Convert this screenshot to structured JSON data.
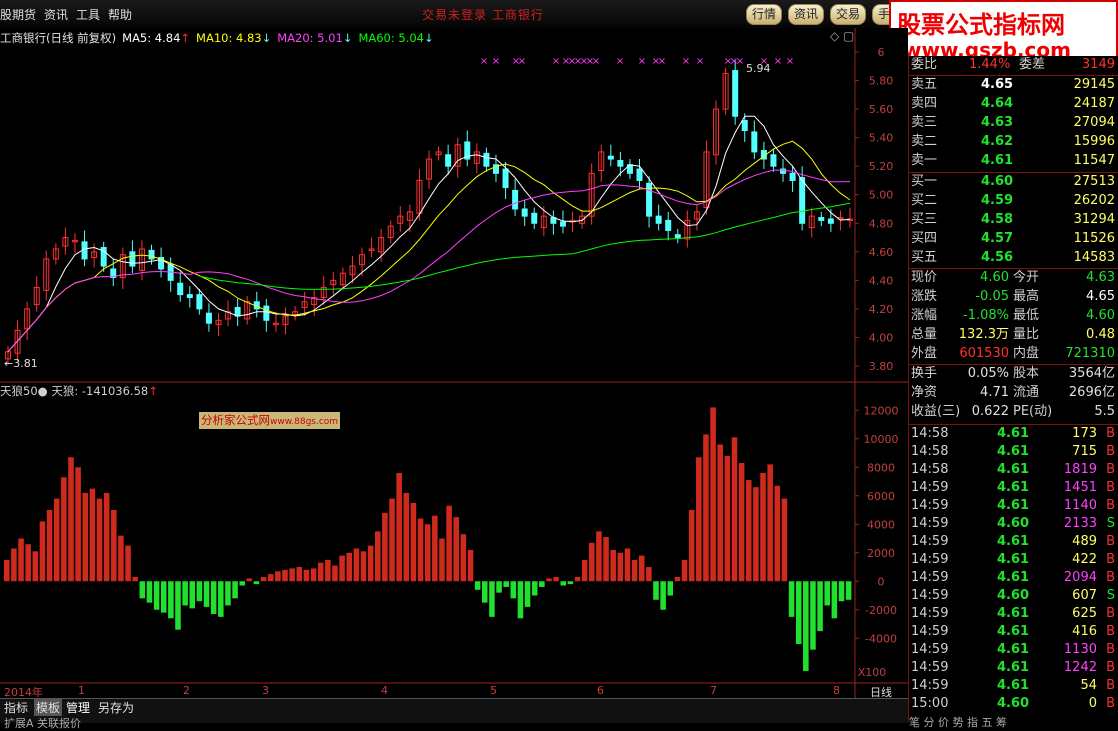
{
  "menu": [
    "股期货",
    "资讯",
    "工具",
    "帮助"
  ],
  "top_notice": "交易未登录    工商银行",
  "top_buttons": [
    "行情",
    "资讯",
    "交易",
    "手"
  ],
  "watermark": {
    "line1": "股票公式指标网",
    "line2": "www.gszb.com"
  },
  "main_legend": {
    "title": "工商银行(日线 前复权)",
    "ma5": "MA5: 4.84",
    "ma10": "MA10: 4.83",
    "ma20": "MA20: 5.01",
    "ma60": "MA60: 5.04",
    "low_label": "3.81",
    "high_label": "5.94"
  },
  "indicator_legend": {
    "name": "天狼50●",
    "value": "天狼: -141036.58"
  },
  "analyst_label": "分析家公式网",
  "analyst_small": "www.88gs.com",
  "price_axis": [
    "6",
    "5.80",
    "5.60",
    "5.40",
    "5.20",
    "5.00",
    "4.80",
    "4.60",
    "4.40",
    "4.20",
    "4.00",
    "3.80"
  ],
  "ind_axis": [
    "12000",
    "10000",
    "8000",
    "6000",
    "4000",
    "2000",
    "0",
    "-2000",
    "-4000"
  ],
  "ind_axis_extra": "X100",
  "x_axis": [
    "2014年",
    "1",
    "2",
    "3",
    "4",
    "5",
    "6",
    "7",
    "8",
    "日线"
  ],
  "bottom_tabs": [
    "指标",
    "模板",
    "管理",
    "另存为"
  ],
  "bottom_row2": "扩展A  关联报价",
  "quote": {
    "header": {
      "label1": "委比",
      "val1": "1.44%",
      "label2": "委差",
      "val2": "3149"
    },
    "sells": [
      {
        "label": "卖五",
        "price": "4.65",
        "vol": "29145"
      },
      {
        "label": "卖四",
        "price": "4.64",
        "vol": "24187"
      },
      {
        "label": "卖三",
        "price": "4.63",
        "vol": "27094"
      },
      {
        "label": "卖二",
        "price": "4.62",
        "vol": "15996"
      },
      {
        "label": "卖一",
        "price": "4.61",
        "vol": "11547"
      }
    ],
    "buys": [
      {
        "label": "买一",
        "price": "4.60",
        "vol": "27513"
      },
      {
        "label": "买二",
        "price": "4.59",
        "vol": "26202"
      },
      {
        "label": "买三",
        "price": "4.58",
        "vol": "31294"
      },
      {
        "label": "买四",
        "price": "4.57",
        "vol": "11526"
      },
      {
        "label": "买五",
        "price": "4.56",
        "vol": "14583"
      }
    ],
    "stats": [
      {
        "l1": "现价",
        "v1": "4.60",
        "l2": "今开",
        "v2": "4.63"
      },
      {
        "l1": "涨跌",
        "v1": "-0.05",
        "l2": "最高",
        "v2": "4.65"
      },
      {
        "l1": "涨幅",
        "v1": "-1.08%",
        "l2": "最低",
        "v2": "4.60"
      },
      {
        "l1": "总量",
        "v1": "132.3万",
        "l2": "量比",
        "v2": "0.48"
      },
      {
        "l1": "外盘",
        "v1": "601530",
        "l2": "内盘",
        "v2": "721310"
      }
    ],
    "stats2": [
      {
        "l1": "换手",
        "v1": "0.05%",
        "l2": "股本",
        "v2": "3564亿"
      },
      {
        "l1": "净资",
        "v1": "4.71",
        "l2": "流通",
        "v2": "2696亿"
      },
      {
        "l1": "收益(三)",
        "v1": "0.622",
        "l2": "PE(动)",
        "v2": "5.5"
      }
    ],
    "ticks": [
      {
        "t": "14:58",
        "p": "4.61",
        "v": "173",
        "s": "B"
      },
      {
        "t": "14:58",
        "p": "4.61",
        "v": "715",
        "s": "B"
      },
      {
        "t": "14:58",
        "p": "4.61",
        "v": "1819",
        "s": "B"
      },
      {
        "t": "14:59",
        "p": "4.61",
        "v": "1451",
        "s": "B"
      },
      {
        "t": "14:59",
        "p": "4.61",
        "v": "1140",
        "s": "B"
      },
      {
        "t": "14:59",
        "p": "4.60",
        "v": "2133",
        "s": "S"
      },
      {
        "t": "14:59",
        "p": "4.61",
        "v": "489",
        "s": "B"
      },
      {
        "t": "14:59",
        "p": "4.61",
        "v": "422",
        "s": "B"
      },
      {
        "t": "14:59",
        "p": "4.61",
        "v": "2094",
        "s": "B"
      },
      {
        "t": "14:59",
        "p": "4.60",
        "v": "607",
        "s": "S"
      },
      {
        "t": "14:59",
        "p": "4.61",
        "v": "625",
        "s": "B"
      },
      {
        "t": "14:59",
        "p": "4.61",
        "v": "416",
        "s": "B"
      },
      {
        "t": "14:59",
        "p": "4.61",
        "v": "1130",
        "s": "B"
      },
      {
        "t": "14:59",
        "p": "4.61",
        "v": "1242",
        "s": "B"
      },
      {
        "t": "14:59",
        "p": "4.61",
        "v": "54",
        "s": "B"
      },
      {
        "t": "15:00",
        "p": "4.60",
        "v": "0",
        "s": "B"
      }
    ],
    "right_tabs": "笔  分  价  势  指  五  筹"
  },
  "colors": {
    "up": "#ff3030",
    "down": "#54ffff",
    "ma5": "#ffffff",
    "ma10": "#ffff00",
    "ma20": "#ff40ff",
    "ma60": "#00ff00",
    "ind_up": "#d02a1f",
    "ind_down": "#22e030"
  },
  "chart_data": [
    {
      "type": "candlestick",
      "title": "工商银行(日线 前复权)",
      "ylim": [
        3.8,
        6.0
      ],
      "x_ticks": [
        "2014年",
        "1",
        "2",
        "3",
        "4",
        "5",
        "6",
        "7",
        "8"
      ],
      "y_ticks": [
        6,
        5.8,
        5.6,
        5.4,
        5.2,
        5.0,
        4.8,
        4.6,
        4.4,
        4.2,
        4.0,
        3.8
      ],
      "annotations": {
        "low": 3.81,
        "high": 5.94
      },
      "series": [
        {
          "name": "MA5",
          "last": 4.84
        },
        {
          "name": "MA10",
          "last": 4.83
        },
        {
          "name": "MA20",
          "last": 5.01
        },
        {
          "name": "MA60",
          "last": 5.04
        }
      ],
      "close": [
        3.9,
        4.05,
        4.2,
        4.35,
        4.55,
        4.62,
        4.7,
        4.68,
        4.55,
        4.6,
        4.5,
        4.42,
        4.58,
        4.5,
        4.62,
        4.55,
        4.48,
        4.4,
        4.3,
        4.28,
        4.2,
        4.1,
        4.12,
        4.18,
        4.15,
        4.25,
        4.2,
        4.12,
        4.1,
        4.15,
        4.18,
        4.25,
        4.28,
        4.35,
        4.4,
        4.45,
        4.5,
        4.58,
        4.62,
        4.7,
        4.78,
        4.85,
        4.88,
        5.1,
        5.25,
        5.3,
        5.2,
        5.35,
        5.25,
        5.3,
        5.2,
        5.15,
        5.05,
        4.9,
        4.85,
        4.8,
        4.85,
        4.8,
        4.78,
        4.82,
        4.85,
        5.15,
        5.3,
        5.25,
        5.2,
        5.15,
        5.1,
        4.85,
        4.8,
        4.75,
        4.7,
        4.82,
        4.88,
        5.3,
        5.6,
        5.85,
        5.55,
        5.45,
        5.3,
        5.25,
        5.2,
        5.15,
        5.1,
        4.8,
        4.85,
        4.82,
        4.8,
        4.84,
        4.83
      ]
    },
    {
      "type": "bar",
      "title": "天狼",
      "ylabel": "X100",
      "ylim": [
        -7000,
        13000
      ],
      "values": [
        1500,
        2300,
        3000,
        2600,
        2100,
        4200,
        5000,
        5800,
        7300,
        8700,
        8000,
        6200,
        6500,
        5800,
        6200,
        5000,
        3200,
        2500,
        300,
        -1200,
        -1500,
        -2000,
        -2200,
        -2600,
        -3400,
        -1700,
        -1900,
        -1400,
        -1800,
        -2300,
        -2500,
        -1700,
        -1200,
        -300,
        200,
        -200,
        300,
        500,
        700,
        800,
        900,
        1000,
        800,
        900,
        1300,
        1500,
        1100,
        1800,
        2000,
        2300,
        2100,
        2500,
        3500,
        4800,
        5800,
        7600,
        6200,
        5500,
        4400,
        4000,
        4600,
        3000,
        5300,
        4500,
        3300,
        2200,
        -600,
        -1500,
        -2500,
        -800,
        -400,
        -1200,
        -2600,
        -1800,
        -1000,
        -400,
        200,
        300,
        -300,
        -200,
        300,
        1500,
        2700,
        3500,
        3100,
        2200,
        2000,
        2300,
        1500,
        1800,
        1000,
        -1300,
        -2000,
        -1000,
        300,
        1500,
        5000,
        8700,
        10300,
        12200,
        9600,
        8800,
        10100,
        8300,
        7100,
        6600,
        7600,
        8200,
        6700,
        5800,
        -2500,
        -4400,
        -6300,
        -4800,
        -3500,
        -1700,
        -2600,
        -1400,
        -1300
      ]
    }
  ]
}
